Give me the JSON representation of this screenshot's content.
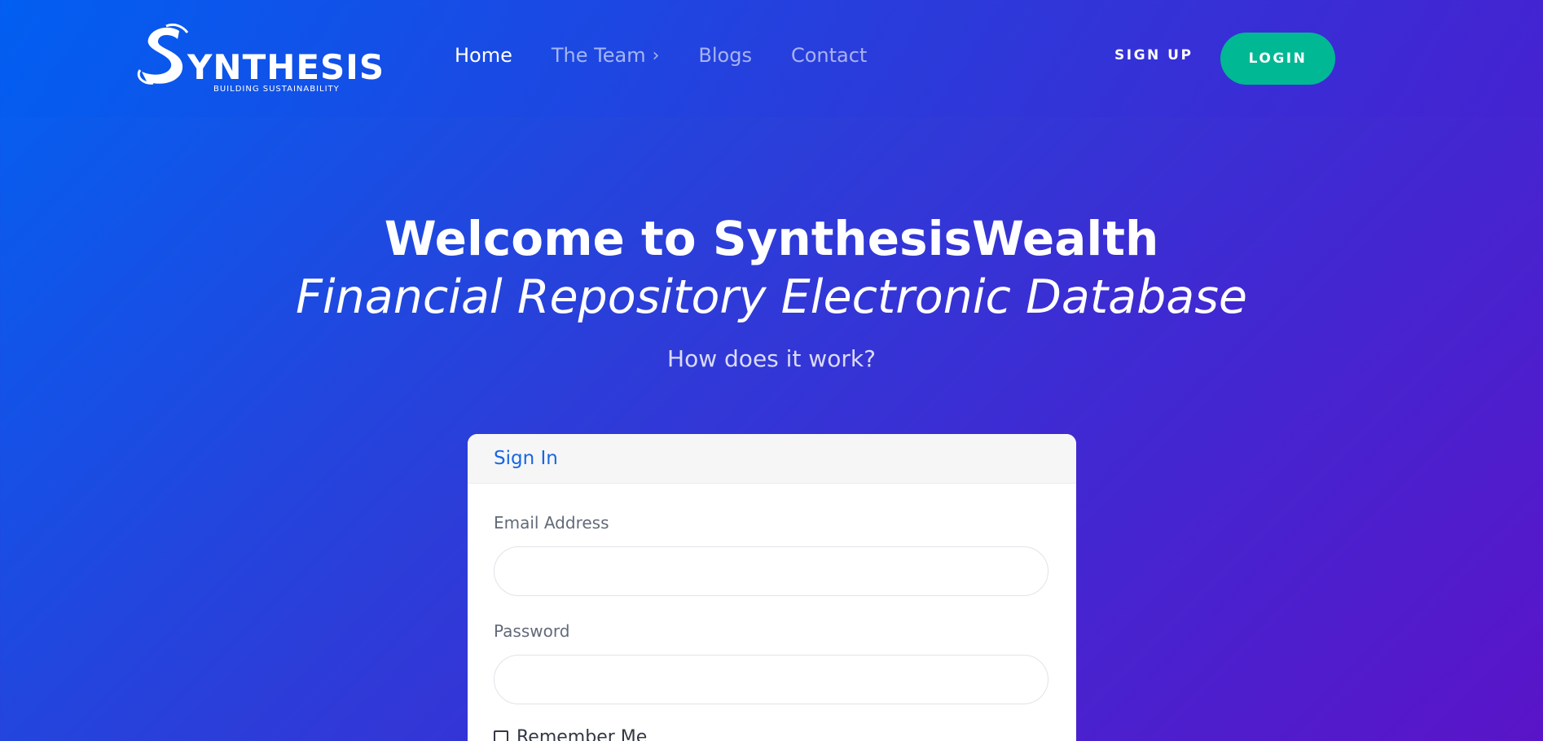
{
  "brand": {
    "name": "YNTHESIS",
    "tagline": "BUILDING SUSTAINABILITY"
  },
  "nav": {
    "items": [
      {
        "label": "Home",
        "active": true
      },
      {
        "label": "The Team",
        "has_dropdown": true
      },
      {
        "label": "Blogs"
      },
      {
        "label": "Contact"
      }
    ],
    "signup_label": "SIGN UP",
    "login_label": "LOGIN"
  },
  "hero": {
    "title": "Welcome to SynthesisWealth",
    "subtitle": "Financial Repository Electronic Database",
    "question": "How does it work?"
  },
  "signin": {
    "header": "Sign In",
    "email_label": "Email Address",
    "email_value": "",
    "password_label": "Password",
    "password_value": "",
    "remember_label": "Remember Me",
    "remember_checked": false
  },
  "colors": {
    "login_button": "#00b894",
    "sign_in_header": "#1767e3"
  }
}
